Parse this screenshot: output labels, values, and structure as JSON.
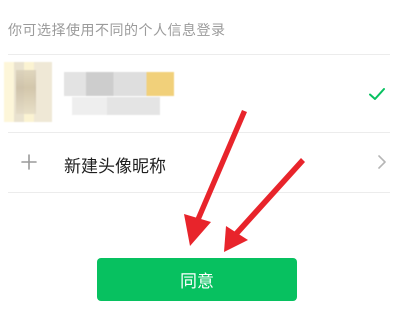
{
  "hint_text": "你可选择使用不同的个人信息登录",
  "profile": {
    "selected": true
  },
  "new_profile_label": "新建头像昵称",
  "agree_button_label": "同意",
  "colors": {
    "accent": "#07c160",
    "arrow": "#e8242b"
  },
  "icons": {
    "check": "check-icon",
    "plus": "plus-icon",
    "chevron": "chevron-right-icon"
  }
}
